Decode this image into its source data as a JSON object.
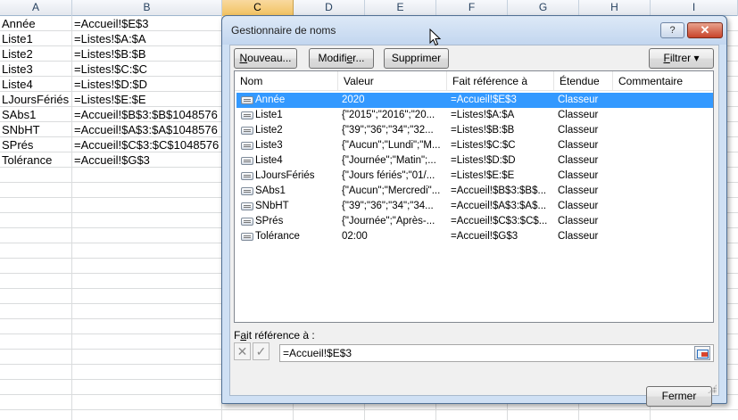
{
  "sheet": {
    "columns": [
      "A",
      "B",
      "C",
      "D",
      "E",
      "F",
      "G",
      "H",
      "I"
    ],
    "selected_column": "C",
    "rows": [
      {
        "a": "Année",
        "b": "=Accueil!$E$3"
      },
      {
        "a": "Liste1",
        "b": "=Listes!$A:$A"
      },
      {
        "a": "Liste2",
        "b": "=Listes!$B:$B"
      },
      {
        "a": "Liste3",
        "b": "=Listes!$C:$C"
      },
      {
        "a": "Liste4",
        "b": "=Listes!$D:$D"
      },
      {
        "a": "LJoursFériés",
        "b": "=Listes!$E:$E"
      },
      {
        "a": "SAbs1",
        "b": "=Accueil!$B$3:$B$1048576"
      },
      {
        "a": "SNbHT",
        "b": "=Accueil!$A$3:$A$1048576"
      },
      {
        "a": "SPrés",
        "b": "=Accueil!$C$3:$C$1048576"
      },
      {
        "a": "Tolérance",
        "b": "=Accueil!$G$3"
      }
    ]
  },
  "dialog": {
    "title": "Gestionnaire de noms",
    "help_label": "?",
    "close_label": "✕",
    "buttons": {
      "new_pre": "",
      "new_u": "N",
      "new_post": "ouveau...",
      "edit_pre": "Modifi",
      "edit_u": "e",
      "edit_post": "r...",
      "delete": "Supprimer",
      "filter_pre": "",
      "filter_u": "F",
      "filter_post": "iltrer ▾",
      "close": "Fermer"
    },
    "columns": {
      "name": "Nom",
      "value": "Valeur",
      "refers_to": "Fait référence à",
      "scope": "Étendue",
      "comment": "Commentaire"
    },
    "names": [
      {
        "name": "Année",
        "value": "2020",
        "refers_to": "=Accueil!$E$3",
        "scope": "Classeur",
        "comment": "",
        "selected": true
      },
      {
        "name": "Liste1",
        "value": "{\"2015\";\"2016\";\"20...",
        "refers_to": "=Listes!$A:$A",
        "scope": "Classeur",
        "comment": ""
      },
      {
        "name": "Liste2",
        "value": "{\"39\";\"36\";\"34\";\"32...",
        "refers_to": "=Listes!$B:$B",
        "scope": "Classeur",
        "comment": ""
      },
      {
        "name": "Liste3",
        "value": "{\"Aucun\";\"Lundi\";\"M...",
        "refers_to": "=Listes!$C:$C",
        "scope": "Classeur",
        "comment": ""
      },
      {
        "name": "Liste4",
        "value": "{\"Journée\";\"Matin\";...",
        "refers_to": "=Listes!$D:$D",
        "scope": "Classeur",
        "comment": ""
      },
      {
        "name": "LJoursFériés",
        "value": "{\"Jours fériés\";\"01/...",
        "refers_to": "=Listes!$E:$E",
        "scope": "Classeur",
        "comment": ""
      },
      {
        "name": "SAbs1",
        "value": "{\"Aucun\";\"Mercredi\"...",
        "refers_to": "=Accueil!$B$3:$B$...",
        "scope": "Classeur",
        "comment": ""
      },
      {
        "name": "SNbHT",
        "value": "{\"39\";\"36\";\"34\";\"34...",
        "refers_to": "=Accueil!$A$3:$A$...",
        "scope": "Classeur",
        "comment": ""
      },
      {
        "name": "SPrés",
        "value": "{\"Journée\";\"Après-...",
        "refers_to": "=Accueil!$C$3:$C$...",
        "scope": "Classeur",
        "comment": ""
      },
      {
        "name": "Tolérance",
        "value": "02:00",
        "refers_to": "=Accueil!$G$3",
        "scope": "Classeur",
        "comment": ""
      }
    ],
    "refers_to_label_pre": "F",
    "refers_to_label_u": "a",
    "refers_to_label_post": "it référence à :",
    "refers_to_value": "=Accueil!$E$3",
    "cancel_icon": "✕",
    "confirm_icon": "✓"
  },
  "colors": {
    "selection": "#3399ff",
    "column_selected": "#f1c15f",
    "dialog_frame": "#cfe0f4"
  }
}
